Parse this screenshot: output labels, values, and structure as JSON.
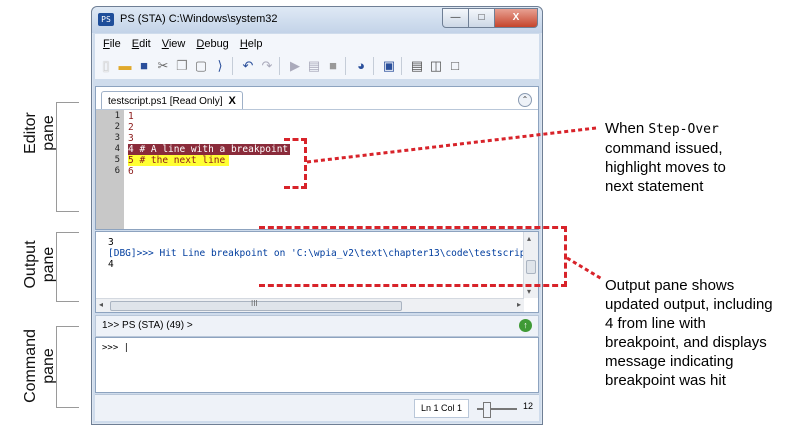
{
  "window": {
    "title": "PS (STA)  C:\\Windows\\system32",
    "app_icon_text": "PS",
    "min_glyph": "—",
    "max_glyph": "□",
    "close_glyph": "X"
  },
  "menu": {
    "items": [
      "File",
      "Edit",
      "View",
      "Debug",
      "Help"
    ]
  },
  "toolbar": {
    "icons": [
      "new-icon",
      "open-icon",
      "save-icon",
      "cut-icon",
      "copy-icon",
      "paste-icon",
      "clear-icon",
      "undo-icon",
      "redo-icon",
      "run-icon",
      "run-selection-icon",
      "stop-icon",
      "remote-icon",
      "powershell-icon",
      "layout-1-icon",
      "layout-2-icon",
      "layout-3-icon"
    ]
  },
  "editor": {
    "tab_label": "testscript.ps1 [Read Only]",
    "tab_close": "X",
    "lines": [
      {
        "no": "1",
        "text": "1"
      },
      {
        "no": "2",
        "text": "2"
      },
      {
        "no": "3",
        "text": "3"
      },
      {
        "no": "4",
        "text": "4 # A line with a breakpoint"
      },
      {
        "no": "5",
        "text": "5 # the next line"
      },
      {
        "no": "6",
        "text": "6"
      }
    ]
  },
  "output": {
    "line1": "3",
    "line2": "[DBG]>>> Hit Line breakpoint on 'C:\\wpia_v2\\text\\chapter13\\code\\testscrip",
    "line3": "4",
    "hscroll_glyph": "III"
  },
  "command": {
    "prompt_label": "1>> PS (STA) (49) >",
    "input_prompt": ">>> |"
  },
  "status": {
    "position": "Ln 1  Col 1",
    "zoom": "12"
  },
  "labels": {
    "editor": [
      "Editor",
      "pane"
    ],
    "output": [
      "Output",
      "pane"
    ],
    "command": [
      "Command",
      "pane"
    ]
  },
  "annotations": {
    "step_over": {
      "prefix": "When ",
      "code": "Step-Over",
      "rest": [
        "command issued,",
        "highlight moves to",
        "next statement"
      ]
    },
    "output_pane": [
      "Output pane shows",
      "updated output, including",
      "4 from line with",
      "breakpoint, and displays",
      "message indicating",
      "breakpoint was hit"
    ]
  },
  "colors": {
    "annotation_dash": "#d8232a",
    "breakpoint_bg": "#8a2b3a",
    "current_line_bg": "#ffff33"
  }
}
